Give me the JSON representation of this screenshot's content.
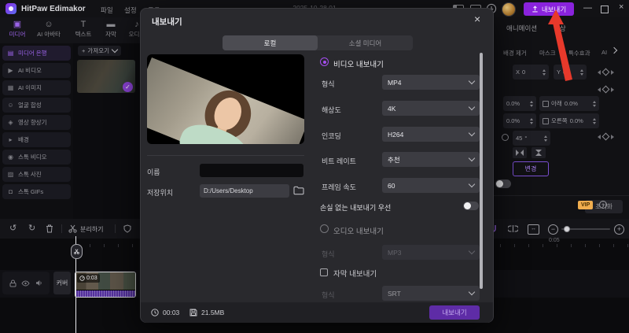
{
  "titlebar": {
    "app_name": "HitPaw Edimakor",
    "menus": [
      "파일",
      "설정",
      "도움"
    ],
    "project_title": "2025-10-28 01",
    "export_label": "내보내기"
  },
  "top_toolbar": {
    "items": [
      {
        "label": "미디어",
        "icon": "▣",
        "active": true
      },
      {
        "label": "AI 아바타",
        "icon": "☺",
        "active": false
      },
      {
        "label": "텍스트",
        "icon": "T",
        "active": false
      },
      {
        "label": "자막",
        "icon": "▬",
        "active": false
      },
      {
        "label": "오디오",
        "icon": "♪",
        "active": false
      }
    ]
  },
  "sidebar": {
    "items": [
      {
        "label": "미디어 은행",
        "icon": "▤",
        "active": true
      },
      {
        "label": "AI 비디오",
        "icon": "▶",
        "active": false
      },
      {
        "label": "AI 이미지",
        "icon": "▦",
        "active": false
      },
      {
        "label": "얼굴 합성",
        "icon": "☺",
        "active": false
      },
      {
        "label": "영상 향상기",
        "icon": "◈",
        "active": false
      },
      {
        "label": "배경",
        "icon": "▸",
        "active": false
      },
      {
        "label": "스톡 비디오",
        "icon": "◉",
        "active": false
      },
      {
        "label": "스톡 사진",
        "icon": "▨",
        "active": false
      },
      {
        "label": "스톡 GIFs",
        "icon": "◘",
        "active": false
      }
    ]
  },
  "media_panel": {
    "import_label": "가져오기"
  },
  "right_panel": {
    "tabs": [
      {
        "label": "애니메이션",
        "active": true
      },
      {
        "label": "색상",
        "active": false
      }
    ],
    "subtabs": [
      "배경 제거",
      "마스크",
      "특수효과",
      "AI"
    ],
    "x_label": "X",
    "x_value": "0",
    "y_label": "Y",
    "y_value": "0",
    "pct1": "0.0%",
    "below_label": "아래",
    "below_value": "0.0%",
    "pct2": "0.0%",
    "right_label": "오른쪽",
    "right_value": "0.0%",
    "rotation_value": "45",
    "rotation_unit": "°",
    "change_button": "변경",
    "reset_button": "초기화"
  },
  "timeline": {
    "split_label": "분리하기",
    "cover_button": "커버",
    "clip_duration": "0:03",
    "ruler_time": "0:05"
  },
  "dialog": {
    "title": "내보내기",
    "tabs": [
      {
        "label": "로컬",
        "active": true
      },
      {
        "label": "소셜 미디어",
        "active": false
      }
    ],
    "name_label": "이름",
    "name_value": "",
    "location_label": "저장위치",
    "location_value": "D:/Users/Desktop",
    "video_radio_label": "비디오 내보내기",
    "fields": [
      {
        "label": "형식",
        "value": "MP4"
      },
      {
        "label": "해상도",
        "value": "4K"
      },
      {
        "label": "인코딩",
        "value": "H264"
      },
      {
        "label": "비트 레이트",
        "value": "추천"
      },
      {
        "label": "프레임 속도",
        "value": "60"
      }
    ],
    "lossless_label": "손실 없는 내보내기 우선",
    "vip_badge": "VIP",
    "info_glyph": "i",
    "audio_radio_label": "오디오 내보내기",
    "audio_format_label": "형식",
    "audio_format_value": "MP3",
    "subtitle_checkbox_label": "자막 내보내기",
    "subtitle_format_label": "형식",
    "subtitle_format_value": "SRT",
    "footer": {
      "duration": "00:03",
      "size": "21.5MB",
      "export_label": "내보내기"
    }
  },
  "icons": {
    "undo": "↺",
    "redo": "↻",
    "close": "×",
    "minimize": "—",
    "check": "✓",
    "plus": "+",
    "fit": "↔",
    "zoom_out": "−",
    "zoom_in": "+",
    "upload": "↑"
  },
  "colors": {
    "accent_purple": "#8a23dd",
    "dialog_purple": "#5e2ca6",
    "vip_orange": "#f0ad4e",
    "arrow_red": "#e8392b",
    "clip_audio": "#53309c"
  }
}
